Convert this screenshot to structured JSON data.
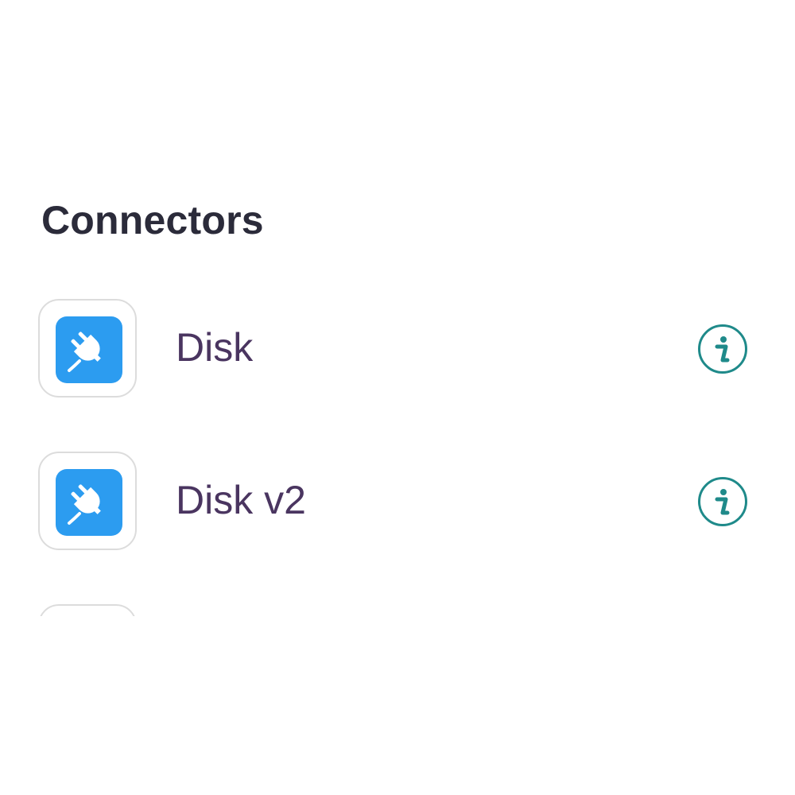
{
  "section": {
    "title": "Connectors"
  },
  "connectors": [
    {
      "label": "Disk",
      "icon": "plug-icon",
      "info_icon": "info-icon"
    },
    {
      "label": "Disk v2",
      "icon": "plug-icon",
      "info_icon": "info-icon"
    },
    {
      "label": "",
      "icon": "",
      "info_icon": ""
    }
  ],
  "colors": {
    "title_text": "#2b2b3a",
    "label_text": "#4a3560",
    "icon_tile": "#2c9cf0",
    "icon_frame_border": "#dcdcdc",
    "info_accent": "#1f8a8a"
  }
}
